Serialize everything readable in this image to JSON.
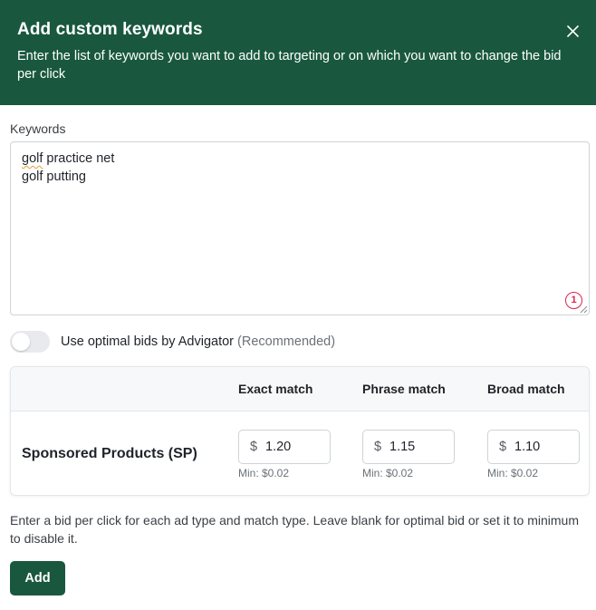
{
  "dialog": {
    "title": "Add custom keywords",
    "subtitle": "Enter the list of keywords you want to add to targeting or on which you want to change the bid per click",
    "close_icon": "close-icon"
  },
  "keywords": {
    "label": "Keywords",
    "lines": [
      {
        "misspelled": "golf",
        "rest": " practice net"
      },
      {
        "misspelled": "",
        "rest": "golf putting"
      }
    ],
    "counter": "1"
  },
  "optimal_bids": {
    "label": "Use optimal bids by Advigator",
    "note": "(Recommended)",
    "enabled": false
  },
  "bid_table": {
    "columns": [
      "Exact match",
      "Phrase match",
      "Broad match"
    ],
    "row_label": "Sponsored Products (SP)",
    "currency": "$",
    "bids": [
      {
        "value": "1.20",
        "min": "Min: $0.02"
      },
      {
        "value": "1.15",
        "min": "Min: $0.02"
      },
      {
        "value": "1.10",
        "min": "Min: $0.02"
      }
    ]
  },
  "help_text": "Enter a bid per click for each ad type and match type. Leave blank for optimal bid or set it to minimum to disable it.",
  "add_button": "Add",
  "colors": {
    "brand": "#19583f",
    "error": "#e0234c"
  }
}
